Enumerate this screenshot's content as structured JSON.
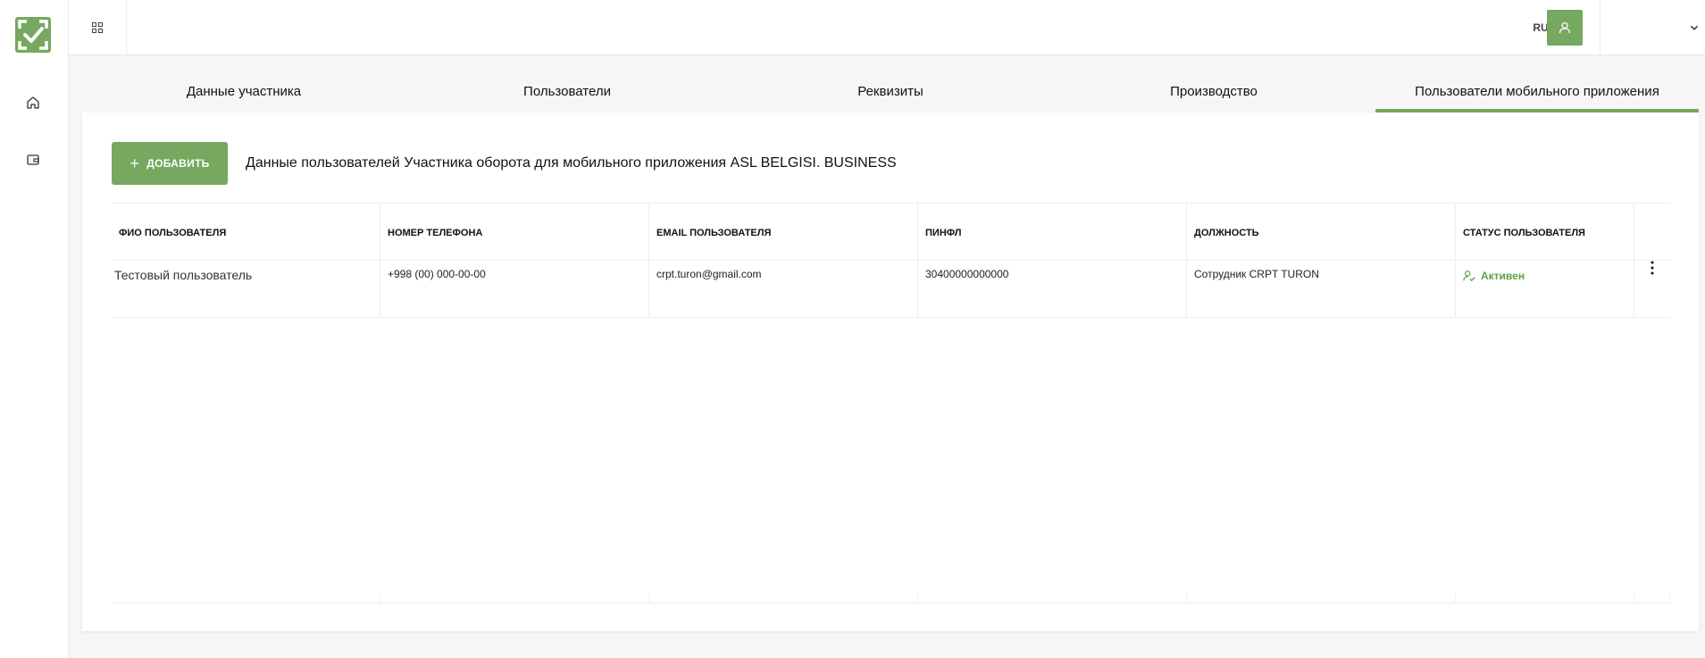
{
  "header": {
    "language": "RU"
  },
  "tabs": [
    {
      "label": "Данные участника"
    },
    {
      "label": "Пользователи"
    },
    {
      "label": "Реквизиты"
    },
    {
      "label": "Производство"
    },
    {
      "label": "Пользователи мобильного приложения",
      "active": true
    }
  ],
  "card": {
    "add_button_label": "ДОБАВИТЬ",
    "add_button_icon": "+",
    "description": "Данные пользователей Участника оборота для мобильного приложения ASL BELGISI. BUSINESS"
  },
  "table": {
    "columns": [
      "ФИО ПОЛЬЗОВАТЕЛЯ",
      "НОМЕР ТЕЛЕФОНА",
      "EMAIL ПОЛЬЗОВАТЕЛЯ",
      "ПИНФЛ",
      "ДОЛЖНОСТЬ",
      "СТАТУС ПОЛЬЗОВАТЕЛЯ"
    ],
    "rows": [
      {
        "name": "Тестовый пользователь",
        "phone": "+998 (00) 000-00-00",
        "email": "crpt.turon@gmail.com",
        "pinfl": "30400000000000",
        "position": "Сотрудник CRPT TURON",
        "status": "Активен"
      }
    ]
  },
  "colors": {
    "accent": "#76a85f",
    "status_active": "#5fa045"
  },
  "icons": {
    "logo": "check-badge-logo",
    "sidebar": [
      "home-icon",
      "wallet-icon"
    ],
    "header": [
      "apps-grid-icon",
      "chevron-down-icon",
      "user-icon"
    ],
    "row": [
      "user-check-icon",
      "more-vertical-icon"
    ]
  }
}
